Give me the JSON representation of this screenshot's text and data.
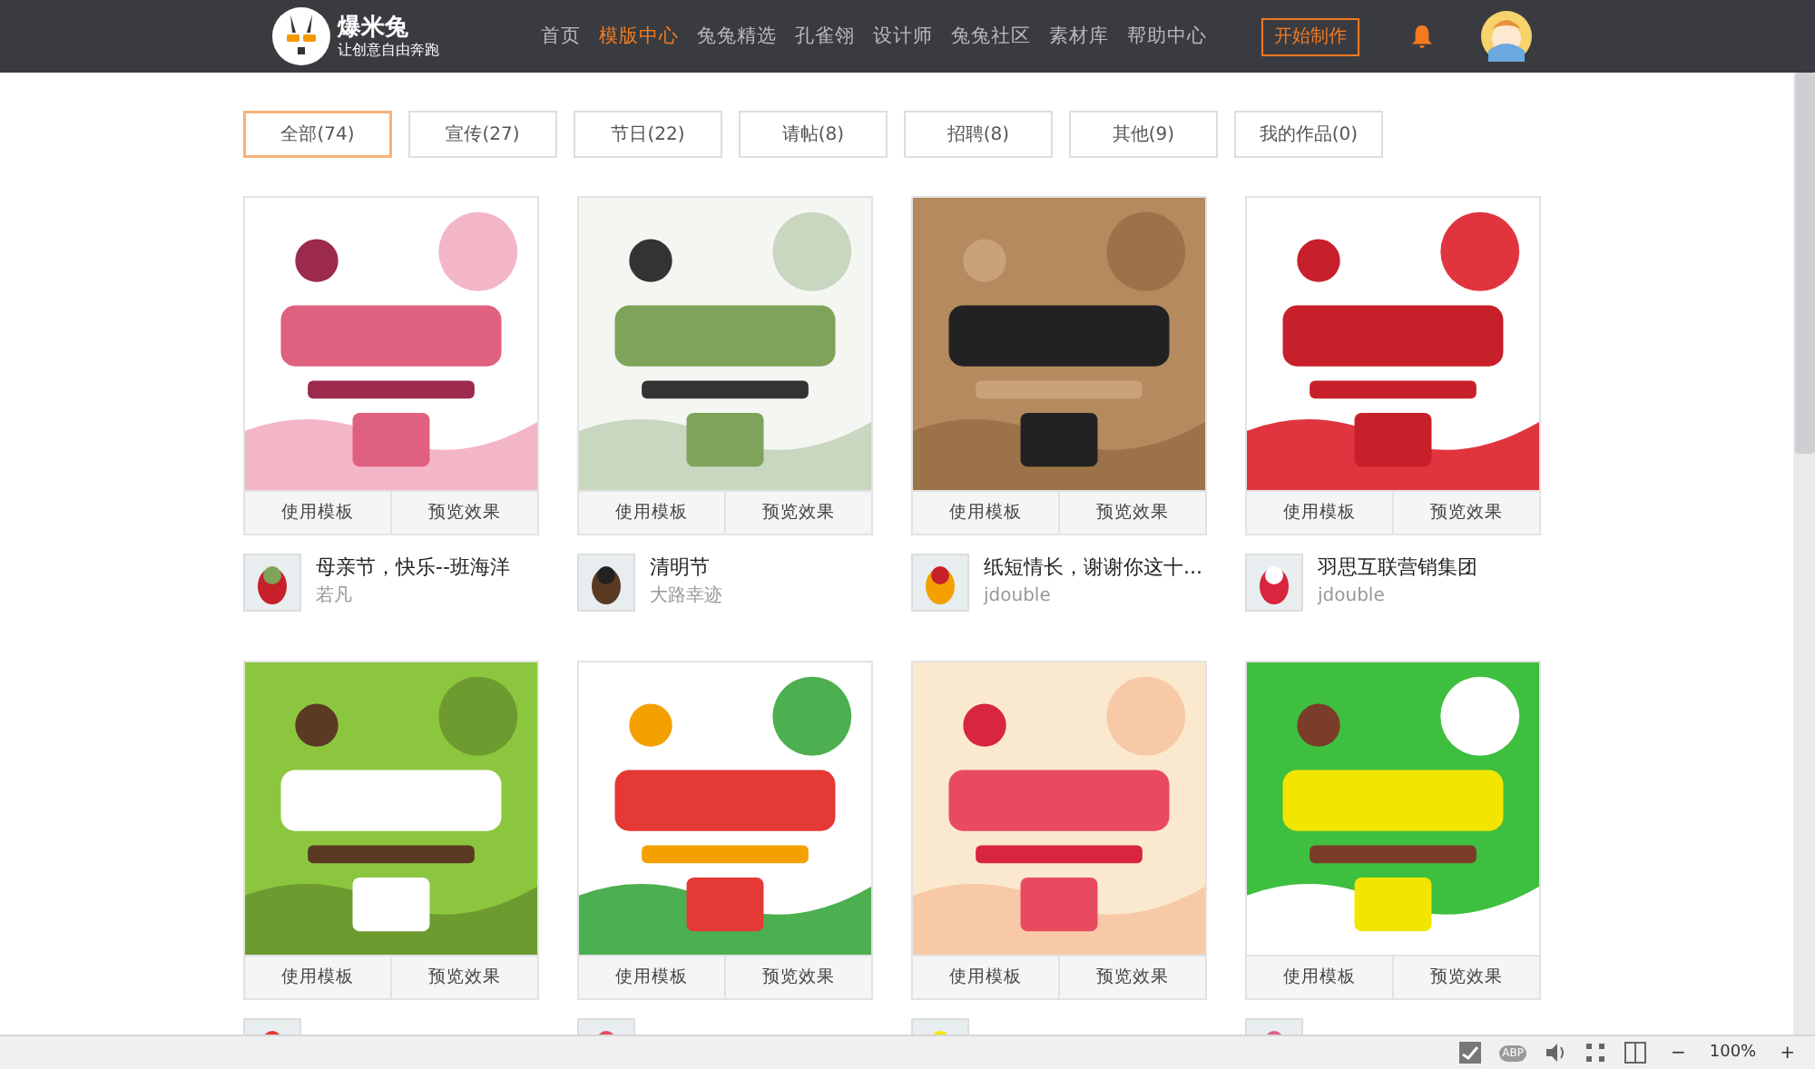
{
  "header": {
    "logo_name": "爆米兔",
    "logo_slogan": "让创意自由奔跑",
    "nav": [
      {
        "label": "首页",
        "selected": false
      },
      {
        "label": "模版中心",
        "selected": true
      },
      {
        "label": "兔兔精选",
        "selected": false
      },
      {
        "label": "孔雀翎",
        "selected": false
      },
      {
        "label": "设计师",
        "selected": false
      },
      {
        "label": "兔兔社区",
        "selected": false
      },
      {
        "label": "素材库",
        "selected": false
      },
      {
        "label": "帮助中心",
        "selected": false
      }
    ],
    "start_button": "开始制作"
  },
  "filters": [
    {
      "label": "全部(74)",
      "selected": true
    },
    {
      "label": "宣传(27)",
      "selected": false
    },
    {
      "label": "节日(22)",
      "selected": false
    },
    {
      "label": "请帖(8)",
      "selected": false
    },
    {
      "label": "招聘(8)",
      "selected": false
    },
    {
      "label": "其他(9)",
      "selected": false
    },
    {
      "label": "我的作品(0)",
      "selected": false
    }
  ],
  "templates": [
    {
      "use": "使用模板",
      "preview": "预览效果",
      "title": "母亲节，快乐--班海洋",
      "author": "若凡"
    },
    {
      "use": "使用模板",
      "preview": "预览效果",
      "title": "清明节",
      "author": "大路幸迹"
    },
    {
      "use": "使用模板",
      "preview": "预览效果",
      "title": "纸短情长，谢谢你这十...",
      "author": "jdouble"
    },
    {
      "use": "使用模板",
      "preview": "预览效果",
      "title": "羽思互联营销集团",
      "author": "jdouble"
    },
    {
      "use": "使用模板",
      "preview": "预览效果"
    },
    {
      "use": "使用模板",
      "preview": "预览效果"
    },
    {
      "use": "使用模板",
      "preview": "预览效果"
    },
    {
      "use": "使用模板",
      "preview": "预览效果"
    }
  ],
  "status_bar": {
    "adblock": "ABP",
    "zoom_out": "−",
    "zoom": "100%",
    "zoom_in": "+"
  }
}
